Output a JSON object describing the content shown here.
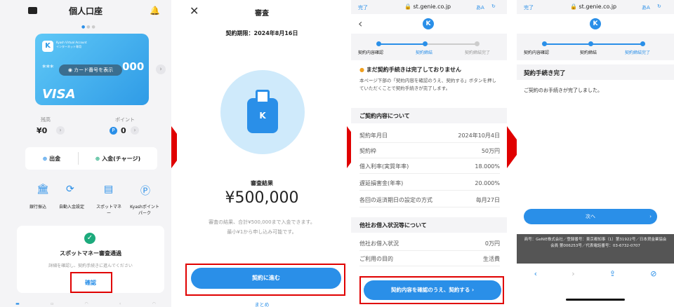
{
  "p1": {
    "title": "個人口座",
    "card_brand": "VISA",
    "card_tag": "Kyash Virtual Account",
    "card_sub": "インターネット専用",
    "card_stars": "***",
    "card_btn": "カード番号を表示",
    "card_tail": "000",
    "balance_label": "残高",
    "balance_value": "¥0",
    "point_label": "ポイント",
    "point_value": "0",
    "withdraw": "出金",
    "deposit": "入金(チャージ)",
    "menu": [
      "銀行振込",
      "自動入金設定",
      "スポットマネー",
      "Kyashポイントパーク"
    ],
    "notice_title": "スポットマネー審査通過",
    "notice_sub": "詳細を確認し、契約手続きに進んでください",
    "confirm": "確認"
  },
  "p2": {
    "title": "審査",
    "period": "契約期限：2024年8月16日",
    "result_label": "審査結果",
    "amount": "¥500,000",
    "desc1": "審査の結果、合計¥500,000まで入金できます。",
    "desc2": "最小¥1から申し込み可能です。",
    "proceed": "契約に進む",
    "close": "まとめ"
  },
  "p3": {
    "done": "完了",
    "url": "st.genie.co.jp",
    "aa": "あA",
    "steps": [
      "契約内容確認",
      "契約締結",
      "契約締結完了"
    ],
    "warn": "まだ契約手続きは完了しておりません",
    "warn_body": "本ページ下部の「契約内容を確認のうえ、契約する」ボタンを押していただくことで契約手続きが完了します。",
    "sec1": "ご契約内容について",
    "rows": [
      [
        "契約年月日",
        "2024年10月4日"
      ],
      [
        "契約枠",
        "50万円"
      ],
      [
        "借入利率(実質年率)",
        "18.000%"
      ],
      [
        "遅延損害金(年率)",
        "20.000%"
      ],
      [
        "各回の返済期日の設定の方式",
        "毎月27日"
      ]
    ],
    "sec2": "他社お借入状況等について",
    "rows2": [
      [
        "他社お借入状況",
        "0万円"
      ],
      [
        "ご利用の目的",
        "生活費"
      ]
    ],
    "cta": "契約内容を確認のうえ、契約する"
  },
  "p4": {
    "done": "完了",
    "url": "st.genie.co.jp",
    "aa": "あA",
    "steps": [
      "契約内容確認",
      "契約締結",
      "契約締結完了"
    ],
    "title": "契約手続き完了",
    "body": "ご契約のお手続きが完了しました。",
    "next": "次へ",
    "footer": "商号：GeNiE株式会社／登録番号：東京都知事（1）第31922号／日本貸金業協会会員 第006253号／代表電話番号：03-6732-0707"
  }
}
